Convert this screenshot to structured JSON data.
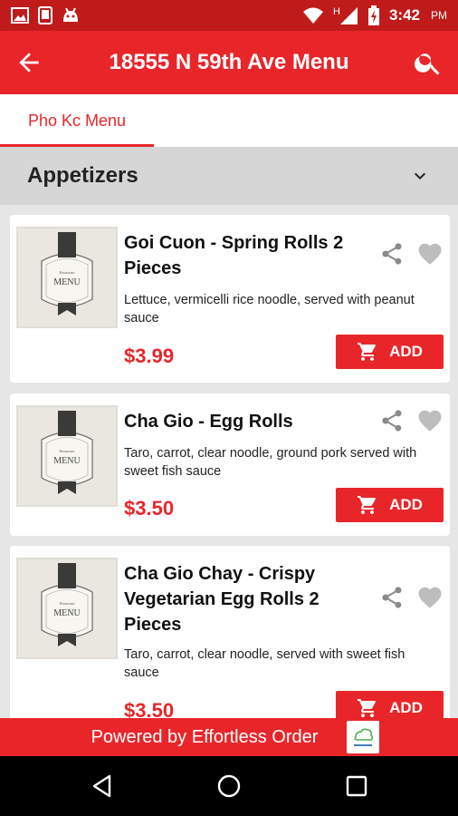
{
  "status_bar": {
    "time": "3:42",
    "ampm": "PM",
    "icons": [
      "image-icon",
      "phone-icon",
      "android-icon",
      "wifi-icon",
      "signal-icon",
      "battery-charging-icon"
    ]
  },
  "app_bar": {
    "title": "18555 N 59th Ave Menu",
    "back_icon": "arrow-back-icon",
    "search_icon": "search-icon"
  },
  "tabs": [
    {
      "label": "Pho Kc Menu",
      "selected": true
    }
  ],
  "category": {
    "label": "Appetizers",
    "icon": "chevron-down-icon"
  },
  "items": [
    {
      "name": "Goi Cuon - Spring Rolls 2 Pieces",
      "description": "Lettuce, vermicelli rice noodle, served with peanut sauce",
      "price": "$3.99",
      "add_label": "ADD"
    },
    {
      "name": "Cha Gio - Egg Rolls",
      "description": "Taro, carrot, clear noodle, ground pork served with sweet fish sauce",
      "price": "$3.50",
      "add_label": "ADD"
    },
    {
      "name": "Cha Gio Chay -  Crispy Vegetarian Egg Rolls 2 Pieces",
      "description": "Taro, carrot, clear noodle, served with sweet fish sauce",
      "price": "$3.50",
      "add_label": "ADD"
    }
  ],
  "footer": {
    "text": "Powered by Effortless Order"
  },
  "colors": {
    "primary": "#e8262a",
    "status_bar": "#bf1b1b",
    "background": "#e6e6e6"
  }
}
